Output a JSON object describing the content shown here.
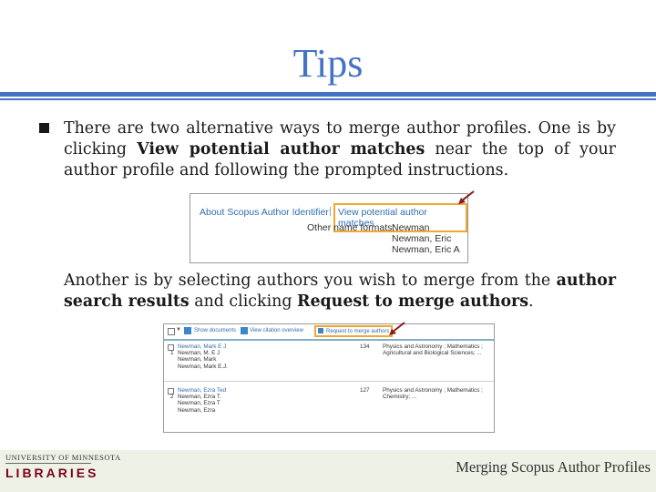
{
  "slide": {
    "title": "Tips",
    "para1_a": "There are two alternative ways to merge author profiles. One is by clicking ",
    "para1_b": "View potential author matches",
    "para1_c": " near the top of your author profile and following the prompted instructions.",
    "para2_a": "Another is by selecting authors you wish to merge from the ",
    "para2_b": "author search results",
    "para2_c": " and clicking ",
    "para2_d": "Request to merge authors",
    "para2_e": "."
  },
  "shot1": {
    "about": "About Scopus Author Identifier",
    "sep": "|",
    "view": "View potential author matches",
    "other_label": "Other name formats:",
    "names": [
      "Newman",
      "Newman, Eric",
      "Newman, Eric A"
    ]
  },
  "shot2": {
    "show_docs": "Show documents",
    "sep": "|",
    "view_cite": "View citation overview",
    "request": "Request to merge authors",
    "rows": [
      {
        "num": "1",
        "main": "Newman, Mark E J",
        "alts": [
          "Newman, M. E J",
          "Newman, Mark",
          "Newman, Mark E.J."
        ],
        "count": "134",
        "subjects": "Physics and Astronomy ; Mathematics ; Agricultural and Biological Sciences; ..."
      },
      {
        "num": "2",
        "main": "Newman, Ezra Ted",
        "alts": [
          "Newman, Ezra T.",
          "Newman, Ezra T",
          "Newman, Ezra"
        ],
        "count": "127",
        "subjects": "Physics and Astronomy ; Mathematics ; Chemistry; ..."
      }
    ]
  },
  "footer": {
    "university": "UNIVERSITY OF MINNESOTA",
    "libraries": "LIBRARIES",
    "title": "Merging Scopus Author Profiles"
  },
  "colors": {
    "accent": "#4472c4",
    "highlight": "#f0a830",
    "arrow": "#8b1a1a",
    "maroon": "#7a0019"
  }
}
